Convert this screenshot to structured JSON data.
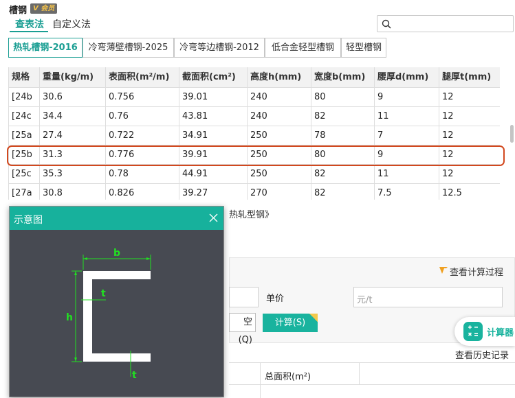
{
  "header": {
    "title": "槽钢",
    "vip_badge": "会员",
    "modes": [
      "查表法",
      "自定义法"
    ],
    "search_placeholder": ""
  },
  "type_tabs": [
    "热轧槽钢-2016",
    "冷弯薄壁槽钢-2025",
    "冷弯等边槽钢-2012",
    "低合金轻型槽钢",
    "轻型槽钢"
  ],
  "table": {
    "columns": [
      "规格",
      "重量(kg/m)",
      "表面积(m²/m)",
      "截面积(cm²)",
      "高度h(mm)",
      "宽度b(mm)",
      "腰厚d(mm)",
      "腿厚t(mm)"
    ],
    "rows": [
      [
        "[24b",
        "30.6",
        "0.756",
        "39.01",
        "240",
        "80",
        "9",
        "12"
      ],
      [
        "[24c",
        "34.4",
        "0.76",
        "43.81",
        "240",
        "82",
        "11",
        "12"
      ],
      [
        "[25a",
        "27.4",
        "0.722",
        "34.91",
        "250",
        "78",
        "7",
        "12"
      ],
      [
        "[25b",
        "31.3",
        "0.776",
        "39.91",
        "250",
        "80",
        "9",
        "12"
      ],
      [
        "[25c",
        "35.3",
        "0.78",
        "44.91",
        "250",
        "82",
        "11",
        "12"
      ],
      [
        "[27a",
        "30.8",
        "0.826",
        "39.27",
        "270",
        "82",
        "7.5",
        "12.5"
      ]
    ],
    "selected_row": 3
  },
  "background": {
    "standard_note": "热轧型钢》",
    "view_process": "查看计算过程",
    "price_label": "单价",
    "price_placeholder": "元/t",
    "clear_label": "空(Q)",
    "calculate_label": "计算(S)",
    "calculator_label": "计算器",
    "history_label": "查看历史记录",
    "total_area_label": "总面积(m²)"
  },
  "popup": {
    "title": "示意图",
    "labels": {
      "b": "b",
      "h": "h",
      "t_top": "t",
      "t_bottom": "t"
    }
  },
  "colors": {
    "accent": "#1a9e93",
    "highlight": "#d2481e",
    "popup_bg": "#474a52",
    "dimension": "#22e022"
  }
}
